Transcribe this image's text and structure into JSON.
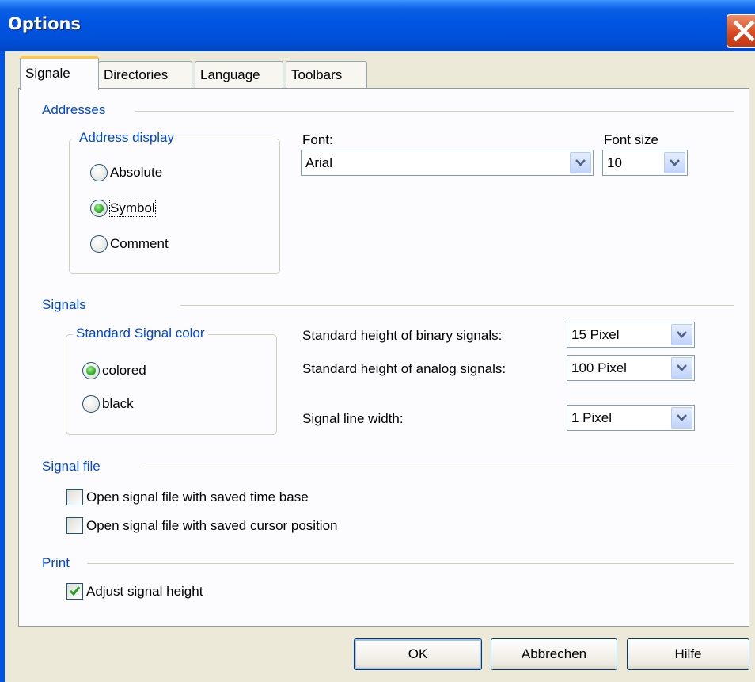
{
  "window": {
    "title": "Options"
  },
  "tabs": [
    "Signale",
    "Directories",
    "Language",
    "Toolbars"
  ],
  "addresses": {
    "section_title": "Addresses",
    "group_title": "Address display",
    "options": [
      "Absolute",
      "Symbol",
      "Comment"
    ],
    "selected": "Symbol",
    "font_label": "Font:",
    "font_value": "Arial",
    "font_size_label": "Font size",
    "font_size_value": "10"
  },
  "signals": {
    "section_title": "Signals",
    "group_title": "Standard Signal color",
    "options": [
      "colored",
      "black"
    ],
    "selected": "colored",
    "binary_label": "Standard height of binary signals:",
    "binary_value": "15 Pixel",
    "analog_label": "Standard height of analog signals:",
    "analog_value": "100 Pixel",
    "linewidth_label": "Signal line width:",
    "linewidth_value": "1 Pixel"
  },
  "signal_file": {
    "section_title": "Signal file",
    "check_time_base": {
      "label": "Open signal file with saved time base",
      "checked": false
    },
    "check_cursor": {
      "label": "Open signal file with saved cursor position",
      "checked": false
    }
  },
  "print": {
    "section_title": "Print",
    "check_adjust": {
      "label": "Adjust signal height",
      "checked": true
    }
  },
  "buttons": {
    "ok": "OK",
    "cancel": "Abbrechen",
    "help": "Hilfe"
  },
  "colors": {
    "section_blue": "#0046d5",
    "titlebar": "#0054e3",
    "close_red": "#d8451d",
    "radio_green": "#21a121",
    "check_green": "#21a121"
  }
}
